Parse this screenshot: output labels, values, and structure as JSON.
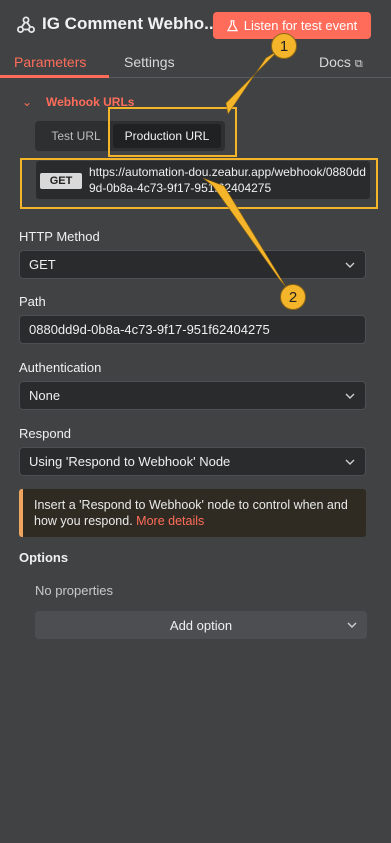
{
  "header": {
    "title": "IG Comment Webho...",
    "listen_label": "Listen for test event",
    "node_icon": "webhook-icon",
    "flask_icon": "flask-icon"
  },
  "tabs": {
    "parameters": "Parameters",
    "settings": "Settings",
    "docs": "Docs",
    "docs_icon": "external-link-icon"
  },
  "webhook": {
    "section_label": "Webhook URLs",
    "toggle": {
      "test": "Test URL",
      "production": "Production URL",
      "selected": "Production URL"
    },
    "method": "GET",
    "url": "https://automation-dou.zeabur.app/webhook/0880dd9d-0b8a-4c73-9f17-951f62404275"
  },
  "fields": {
    "http_method": {
      "label": "HTTP Method",
      "value": "GET"
    },
    "path": {
      "label": "Path",
      "value": "0880dd9d-0b8a-4c73-9f17-951f62404275"
    },
    "authentication": {
      "label": "Authentication",
      "value": "None"
    },
    "respond": {
      "label": "Respond",
      "value": "Using 'Respond to Webhook' Node"
    }
  },
  "notice": {
    "text": "Insert a 'Respond to Webhook' node to control when and how you respond.",
    "link": "More details"
  },
  "options": {
    "label": "Options",
    "empty": "No properties",
    "add_label": "Add option"
  },
  "annotations": {
    "marker_1": "1",
    "marker_2": "2",
    "color": "#f4b52b"
  },
  "colors": {
    "accent": "#ff6d5a",
    "background": "#414244",
    "notice_border": "#f0a55f"
  }
}
